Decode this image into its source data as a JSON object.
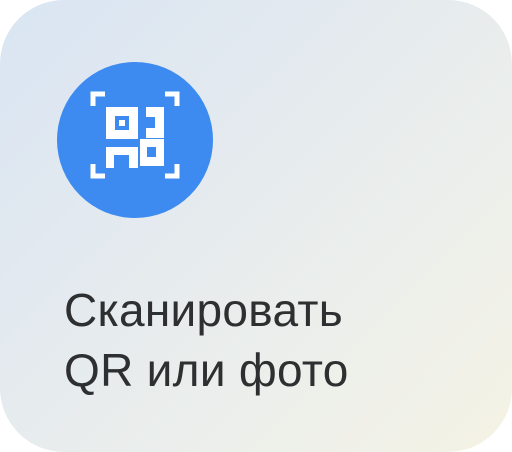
{
  "card": {
    "title_lines": [
      "Сканировать",
      "QR или фото"
    ],
    "icon": "qr-scan-icon",
    "accent_color": "#3d8af0"
  }
}
